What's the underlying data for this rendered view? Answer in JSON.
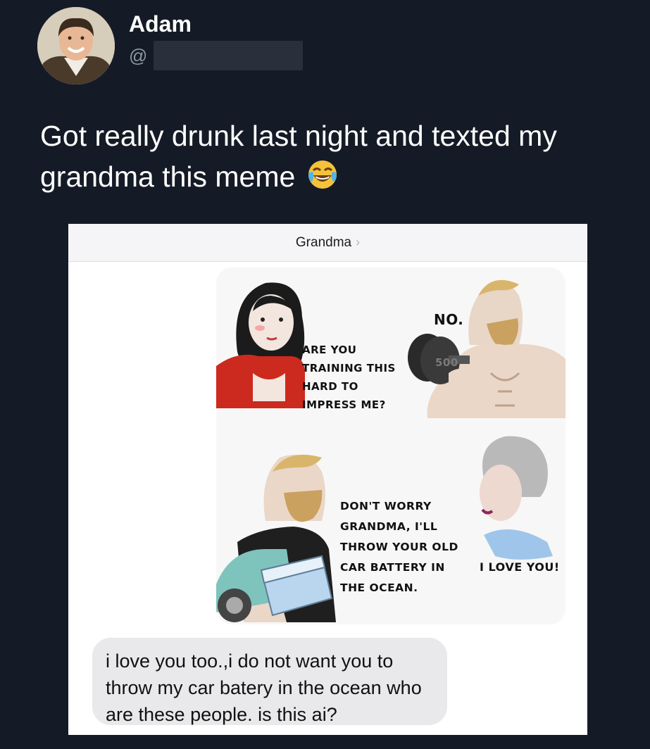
{
  "author": {
    "name": "Adam",
    "handle_prefix": "@"
  },
  "tweet": {
    "text": "Got really drunk last night and texted my grandma this meme",
    "emoji": "face-with-tears-of-joy"
  },
  "conversation": {
    "contact": "Grandma",
    "meme": {
      "panel1_question": "ARE YOU TRAINING THIS HARD TO IMPRESS ME?",
      "panel1_answer": "NO.",
      "dumbbell_label": "500",
      "panel2_statement": "DON'T WORRY GRANDMA, I'LL THROW YOUR OLD CAR BATTERY IN THE OCEAN.",
      "panel2_reply": "I LOVE YOU!"
    },
    "reply": "i love you too.,i do not want you to throw my car batery in the ocean who are these people. is this ai?"
  },
  "colors": {
    "background": "#151b26",
    "bubble_gray": "#e9e9eb",
    "handle_gray": "#8b98a5"
  }
}
